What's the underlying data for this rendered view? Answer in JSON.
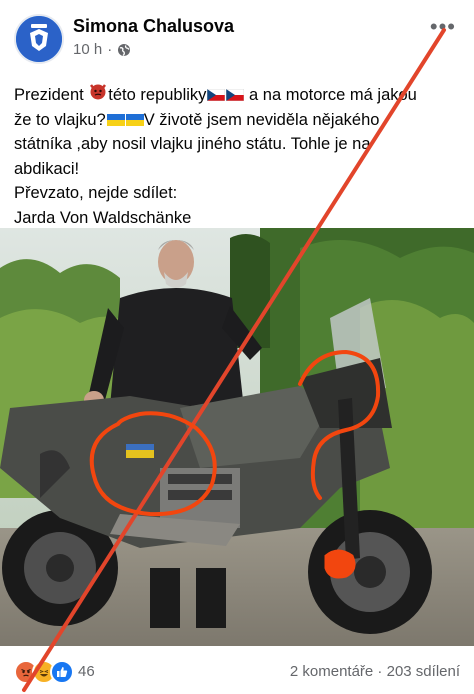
{
  "post": {
    "author": "Simona Chalusova",
    "time": "10 h",
    "dot": "·",
    "more_glyph": "•••",
    "lines": [
      {
        "pre": "Prezident ",
        "mid": "této republiky",
        "post": " a na motorce má jakou"
      },
      {
        "pre": "že to vlajku?",
        "post": "V životě jsem neviděla nějakého"
      }
    ],
    "plain_lines": [
      "státníka ,aby nosil vlajku jiného státu. Tohle je na",
      "abdikaci!",
      "Převzato, nejde sdílet:",
      "Jarda Von Waldschänke"
    ]
  },
  "footer": {
    "reaction_count": "46",
    "comments": "2 komentáře",
    "sep": " · ",
    "shares": "203 sdílení"
  },
  "colors": {
    "meta": "#65676b",
    "angry": "#e8663b",
    "haha": "#f7b125",
    "like": "#1877f2",
    "strike_line": "#e2452b",
    "annotation": "#f2460f"
  },
  "icons": {
    "globe": "globe-icon",
    "more": "more-options-icon",
    "like": "like-reaction-icon",
    "haha": "haha-reaction-icon",
    "angry": "angry-reaction-icon"
  }
}
